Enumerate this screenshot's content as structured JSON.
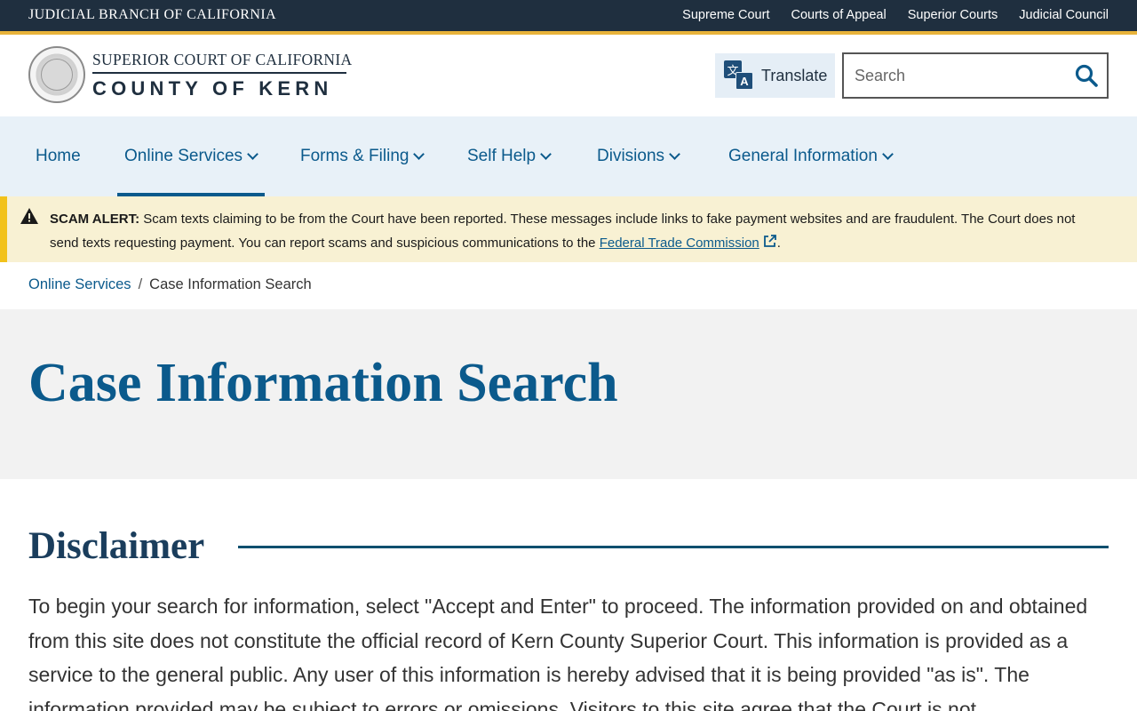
{
  "topbar": {
    "branch_title": "JUDICIAL BRANCH OF CALIFORNIA",
    "links": [
      "Supreme Court",
      "Courts of Appeal",
      "Superior Courts",
      "Judicial Council"
    ]
  },
  "header": {
    "logo_top": "SUPERIOR COURT OF CALIFORNIA",
    "logo_bottom": "COUNTY OF KERN",
    "translate_label": "Translate",
    "search_placeholder": "Search"
  },
  "nav": {
    "items": [
      {
        "label": "Home",
        "has_dropdown": false
      },
      {
        "label": "Online Services",
        "has_dropdown": true,
        "active": true
      },
      {
        "label": "Forms & Filing",
        "has_dropdown": true
      },
      {
        "label": "Self Help",
        "has_dropdown": true
      },
      {
        "label": "Divisions",
        "has_dropdown": true
      },
      {
        "label": "General Information",
        "has_dropdown": true
      }
    ]
  },
  "alert": {
    "label": "SCAM ALERT:",
    "text": " Scam texts claiming to be from the Court have been reported. These messages include links to fake payment websites and are fraudulent. The Court does not send texts requesting payment. You can report scams and suspicious communications to the ",
    "link_text": "Federal Trade Commission",
    "trailing": "."
  },
  "breadcrumb": {
    "parent": "Online Services",
    "separator": "/",
    "current": "Case Information Search"
  },
  "page": {
    "title": "Case Information Search",
    "section_heading": "Disclaimer",
    "body": "To begin your search for information, select \"Accept and Enter\" to proceed. The information provided on and obtained from this site does not constitute the official record of Kern County Superior Court. This information is provided as a service to the general public. Any user of this information is hereby advised that it is being provided \"as is\". The information provided may be subject to errors or omissions. Visitors to this site agree that the Court is not"
  },
  "colors": {
    "topbar": "#1f2f3f",
    "accent_gold": "#e8b33a",
    "link_blue": "#0b5a8c",
    "nav_bg": "#e8f1f8",
    "alert_bg": "#f8f1d3",
    "alert_border": "#f2c21b",
    "hero_bg": "#f2f2f2"
  },
  "icons": {
    "translate": "translate-icon",
    "search": "search-icon",
    "alert": "warning-icon",
    "external": "external-link-icon",
    "dropdown": "chevron-down-icon"
  }
}
